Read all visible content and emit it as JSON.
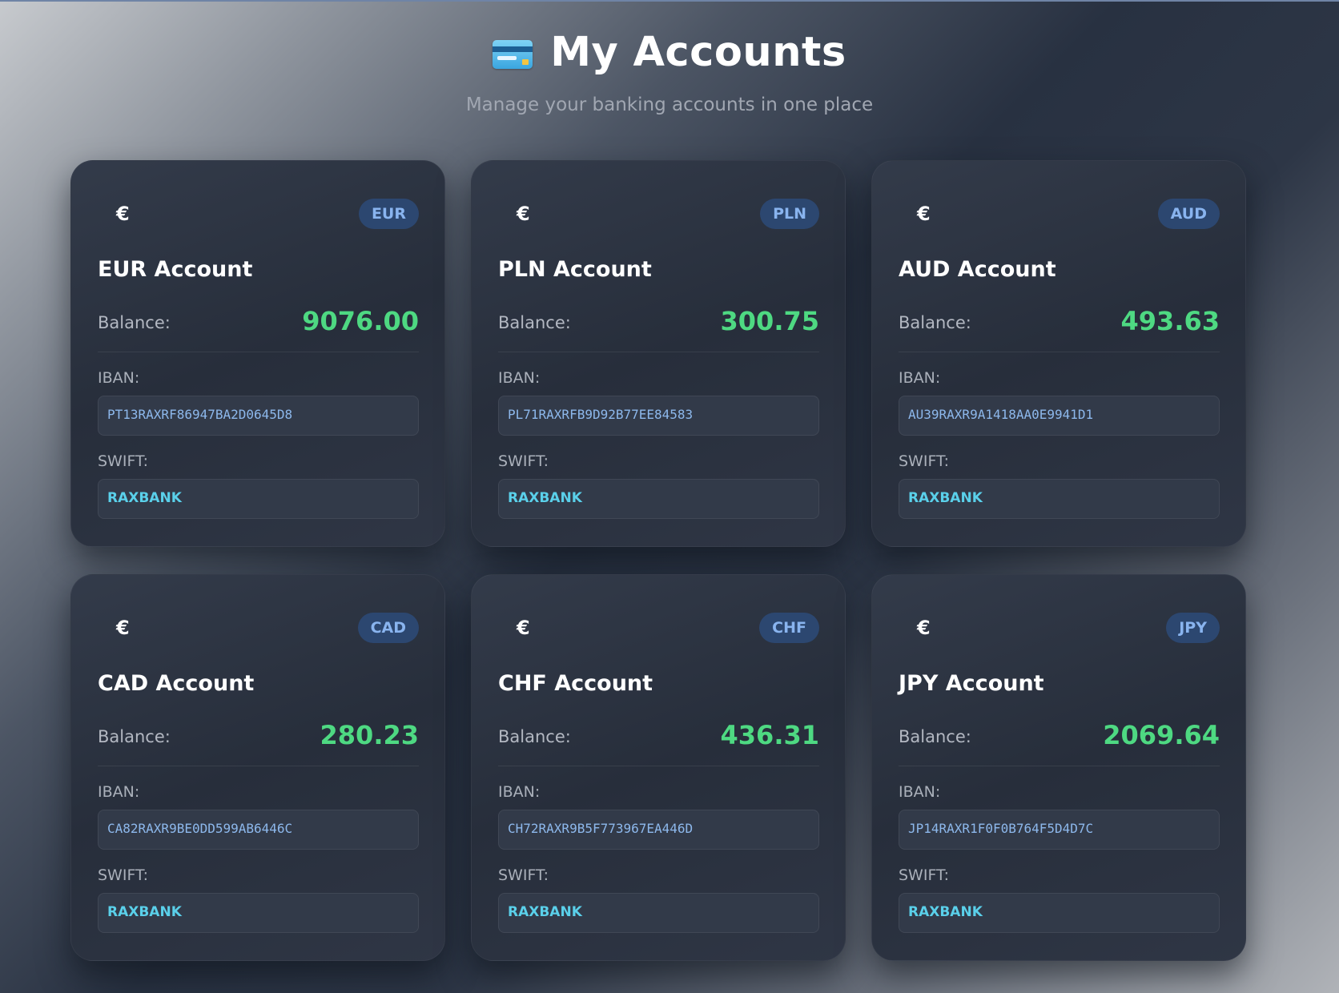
{
  "header": {
    "title": "My Accounts",
    "title_icon": "credit-card-icon",
    "subtitle": "Manage your banking accounts in one place"
  },
  "labels": {
    "balance": "Balance:",
    "iban": "IBAN:",
    "swift": "SWIFT:"
  },
  "colors": {
    "balance": "#4ed982",
    "badge_bg": "#2c4770",
    "badge_text": "#89b4ef",
    "iban_text": "#8db8ec",
    "swift_text": "#5ad0ea"
  },
  "accounts": [
    {
      "symbol": "€",
      "currency": "EUR",
      "name": "EUR Account",
      "balance": "9076.00",
      "iban": "PT13RAXRF86947BA2D0645D8",
      "swift": "RAXBANK"
    },
    {
      "symbol": "€",
      "currency": "PLN",
      "name": "PLN Account",
      "balance": "300.75",
      "iban": "PL71RAXRFB9D92B77EE84583",
      "swift": "RAXBANK"
    },
    {
      "symbol": "€",
      "currency": "AUD",
      "name": "AUD Account",
      "balance": "493.63",
      "iban": "AU39RAXR9A1418AA0E9941D1",
      "swift": "RAXBANK"
    },
    {
      "symbol": "€",
      "currency": "CAD",
      "name": "CAD Account",
      "balance": "280.23",
      "iban": "CA82RAXR9BE0DD599AB6446C",
      "swift": "RAXBANK"
    },
    {
      "symbol": "€",
      "currency": "CHF",
      "name": "CHF Account",
      "balance": "436.31",
      "iban": "CH72RAXR9B5F773967EA446D",
      "swift": "RAXBANK"
    },
    {
      "symbol": "€",
      "currency": "JPY",
      "name": "JPY Account",
      "balance": "2069.64",
      "iban": "JP14RAXR1F0F0B764F5D4D7C",
      "swift": "RAXBANK"
    }
  ]
}
